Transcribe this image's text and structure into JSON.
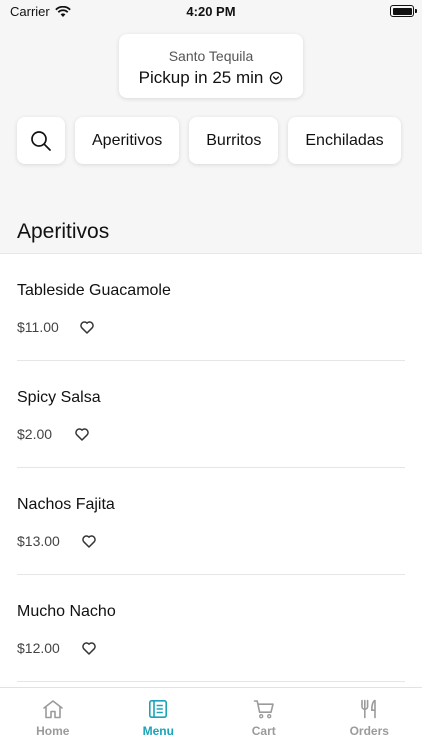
{
  "status_bar": {
    "carrier": "Carrier",
    "time": "4:20 PM"
  },
  "store": {
    "name": "Santo Tequila",
    "pickup": "Pickup in 25 min"
  },
  "categories": [
    "Aperitivos",
    "Burritos",
    "Enchiladas"
  ],
  "section": {
    "title": "Aperitivos"
  },
  "items": [
    {
      "name": "Tableside Guacamole",
      "price": "$11.00"
    },
    {
      "name": "Spicy Salsa",
      "price": "$2.00"
    },
    {
      "name": "Nachos Fajita",
      "price": "$13.00"
    },
    {
      "name": "Mucho Nacho",
      "price": "$12.00"
    }
  ],
  "tabs": [
    {
      "label": "Home",
      "icon": "home-icon"
    },
    {
      "label": "Menu",
      "icon": "menu-book-icon"
    },
    {
      "label": "Cart",
      "icon": "cart-icon"
    },
    {
      "label": "Orders",
      "icon": "fork-knife-icon"
    }
  ],
  "active_tab": "Menu",
  "colors": {
    "accent": "#1aa3b9",
    "inactive": "#9b9b9b"
  }
}
